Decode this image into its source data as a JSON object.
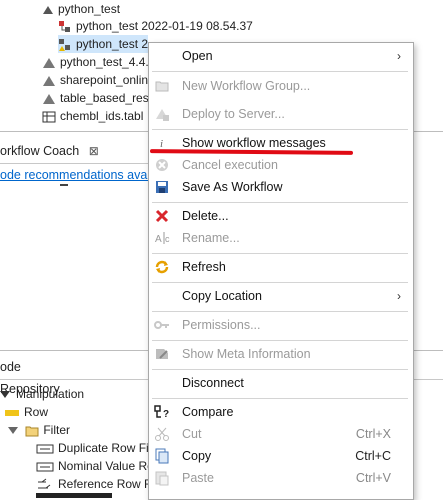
{
  "tree": {
    "items": [
      {
        "label": "python_test",
        "indent": 0
      },
      {
        "label": "python_test 2022-01-19 08.54.37",
        "indent": 1
      },
      {
        "label": "python_test 2",
        "indent": 1,
        "selected": true
      },
      {
        "label": "python_test_4.4.",
        "indent": 0
      },
      {
        "label": "sharepoint_onlin",
        "indent": 0
      },
      {
        "label": "table_based_rest",
        "indent": 0
      },
      {
        "label": "chembl_ids.tabl",
        "indent": 0
      }
    ]
  },
  "coach": {
    "tab_label": "orkflow Coach",
    "close_glyph": "⊠",
    "link_text": "ode recommendations avai"
  },
  "repository": {
    "tab_label": "ode Repository",
    "items": [
      {
        "label": "Manipulation"
      },
      {
        "label": "Row"
      },
      {
        "label": "Filter"
      },
      {
        "label": "Duplicate Row Fi"
      },
      {
        "label": "Nominal Value Re"
      },
      {
        "label": "Reference Row Fi"
      }
    ]
  },
  "menu": {
    "items": [
      {
        "label": "Open",
        "submenu": true,
        "disabled": false,
        "icon": "none"
      },
      {
        "label": "New Workflow Group...",
        "disabled": true,
        "icon": "folder-icon"
      },
      {
        "label": "Deploy to Server...",
        "disabled": true,
        "icon": "deploy-icon"
      },
      {
        "label": "Show workflow messages",
        "disabled": false,
        "icon": "info-icon"
      },
      {
        "label": "Cancel execution",
        "disabled": true,
        "icon": "cancel-icon"
      },
      {
        "label": "Save As Workflow",
        "disabled": false,
        "icon": "save-icon"
      },
      {
        "label": "Delete...",
        "disabled": false,
        "icon": "delete-icon"
      },
      {
        "label": "Rename...",
        "disabled": true,
        "icon": "rename-icon"
      },
      {
        "label": "Refresh",
        "disabled": false,
        "icon": "refresh-icon"
      },
      {
        "label": "Copy Location",
        "submenu": true,
        "disabled": false,
        "icon": "none"
      },
      {
        "label": "Permissions...",
        "disabled": true,
        "icon": "key-icon"
      },
      {
        "label": "Show Meta Information",
        "disabled": true,
        "icon": "meta-icon"
      },
      {
        "label": "Disconnect",
        "disabled": false,
        "icon": "none"
      },
      {
        "label": "Compare",
        "disabled": false,
        "icon": "compare-icon"
      },
      {
        "label": "Cut",
        "shortcut": "Ctrl+X",
        "disabled": true,
        "icon": "cut-icon"
      },
      {
        "label": "Copy",
        "shortcut": "Ctrl+C",
        "disabled": false,
        "icon": "copy-icon"
      },
      {
        "label": "Paste",
        "shortcut": "Ctrl+V",
        "disabled": true,
        "icon": "paste-icon"
      }
    ],
    "submenu_glyph": "›"
  },
  "annotation_color": "#e00a14"
}
